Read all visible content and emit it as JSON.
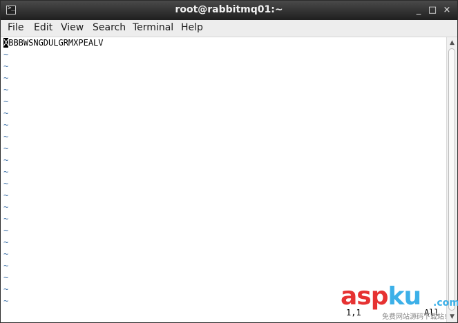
{
  "window": {
    "title": "root@rabbitmq01:~",
    "icon": "terminal-icon",
    "controls": {
      "minimize": "_",
      "maximize": "□",
      "close": "×"
    }
  },
  "menu": {
    "items": [
      "File",
      "Edit",
      "View",
      "Search",
      "Terminal",
      "Help"
    ]
  },
  "editor": {
    "first_line_cursor_char": "X",
    "first_line_rest": "BBBWSNGDULGRMXPEALV",
    "tilde": "~",
    "status_position": "1,1",
    "status_scope": "All"
  },
  "watermark": {
    "logo_left": "asp",
    "logo_right": "ku",
    "suffix": ".com",
    "subtitle": "免费网站源码下载站!"
  }
}
